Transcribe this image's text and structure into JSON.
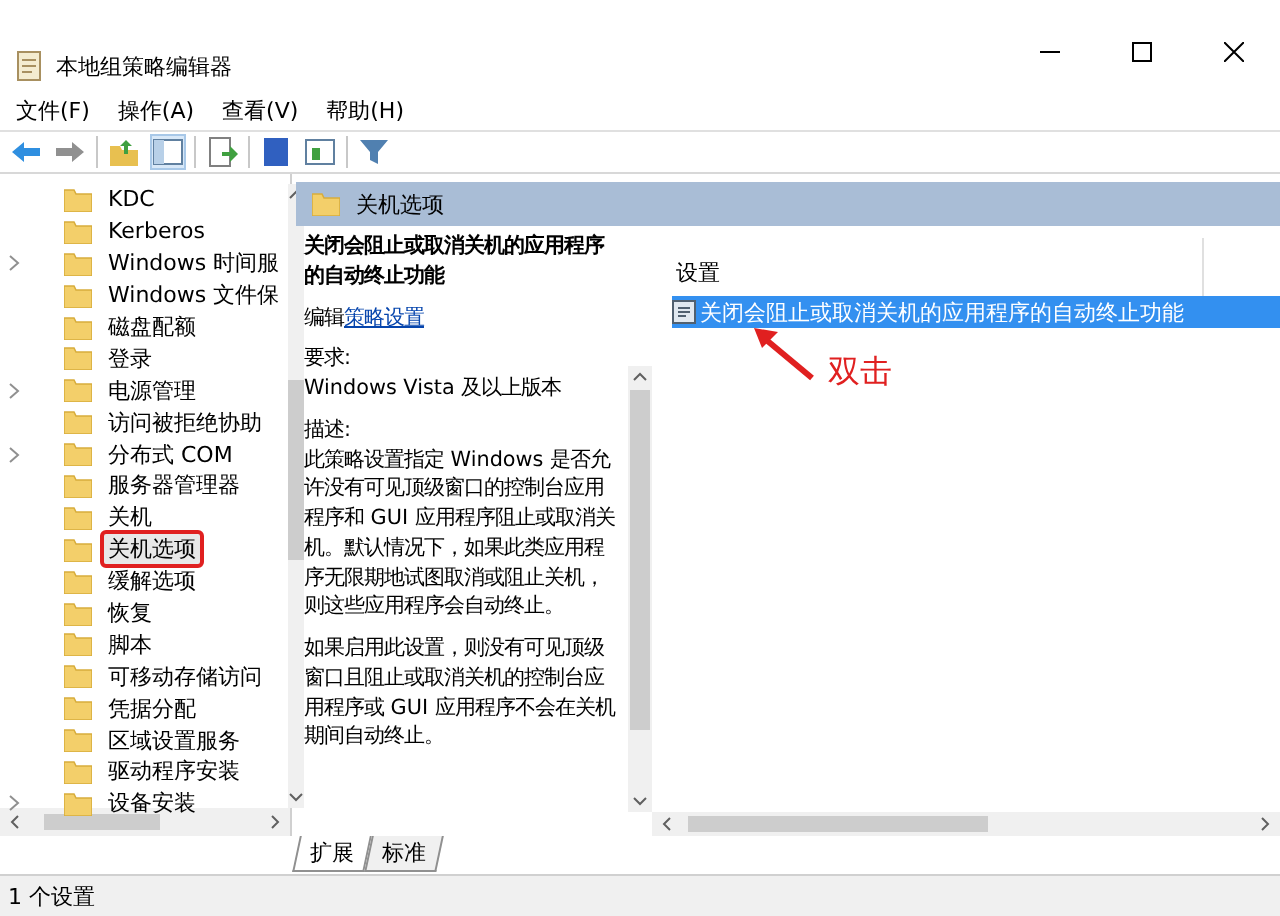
{
  "window": {
    "title": "本地组策略编辑器"
  },
  "menu": [
    "文件(F)",
    "操作(A)",
    "查看(V)",
    "帮助(H)"
  ],
  "toolbar": [
    {
      "kind": "back"
    },
    {
      "kind": "forward"
    },
    {
      "kind": "up"
    },
    {
      "kind": "show-tree"
    },
    {
      "kind": "export"
    },
    {
      "kind": "help"
    },
    {
      "kind": "view"
    },
    {
      "kind": "filter"
    }
  ],
  "tree": [
    {
      "label": "KDC",
      "expandable": false,
      "selected": false
    },
    {
      "label": "Kerberos",
      "expandable": false,
      "selected": false
    },
    {
      "label": "Windows 时间服",
      "expandable": true,
      "selected": false
    },
    {
      "label": "Windows 文件保",
      "expandable": false,
      "selected": false
    },
    {
      "label": "磁盘配额",
      "expandable": false,
      "selected": false
    },
    {
      "label": "登录",
      "expandable": false,
      "selected": false
    },
    {
      "label": "电源管理",
      "expandable": true,
      "selected": false
    },
    {
      "label": "访问被拒绝协助",
      "expandable": false,
      "selected": false
    },
    {
      "label": "分布式 COM",
      "expandable": true,
      "selected": false
    },
    {
      "label": "服务器管理器",
      "expandable": false,
      "selected": false
    },
    {
      "label": "关机",
      "expandable": false,
      "selected": false
    },
    {
      "label": "关机选项",
      "expandable": false,
      "selected": true
    },
    {
      "label": "缓解选项",
      "expandable": false,
      "selected": false
    },
    {
      "label": "恢复",
      "expandable": false,
      "selected": false
    },
    {
      "label": "脚本",
      "expandable": false,
      "selected": false
    },
    {
      "label": "可移动存储访问",
      "expandable": false,
      "selected": false
    },
    {
      "label": "凭据分配",
      "expandable": false,
      "selected": false
    },
    {
      "label": "区域设置服务",
      "expandable": false,
      "selected": false
    },
    {
      "label": "驱动程序安装",
      "expandable": false,
      "selected": false
    },
    {
      "label": "设备安装",
      "expandable": true,
      "selected": false
    }
  ],
  "header": {
    "title": "关机选项"
  },
  "description": {
    "title": "关闭会阻止或取消关机的应用程序的自动终止功能",
    "edit_prefix": "编辑",
    "edit_link": "策略设置",
    "requirements_label": "要求:",
    "requirements": "Windows Vista 及以上版本",
    "description_label": "描述:",
    "paragraphs": [
      "此策略设置指定 Windows 是否允许没有可见顶级窗口的控制台应用程序和 GUI 应用程序阻止或取消关机。默认情况下，如果此类应用程序无限期地试图取消或阻止关机，则这些应用程序会自动终止。",
      "如果启用此设置，则没有可见顶级窗口且阻止或取消关机的控制台应用程序或 GUI 应用程序不会在关机期间自动终止。"
    ]
  },
  "settings": {
    "column": "设置",
    "items": [
      {
        "label": "关闭会阻止或取消关机的应用程序的自动终止功能",
        "selected": true
      }
    ]
  },
  "annotation": {
    "text": "双击"
  },
  "tabs": [
    {
      "label": "扩展",
      "selected": true
    },
    {
      "label": "标准",
      "selected": false
    }
  ],
  "status_bar": "1 个设置"
}
